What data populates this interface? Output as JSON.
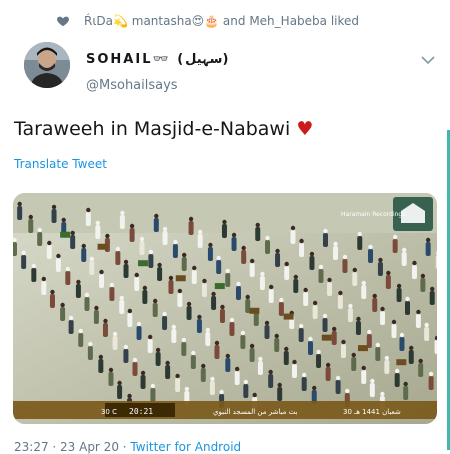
{
  "social_context": {
    "text": "ŔιDa💫 mantasha😍🎂 and Meh_Habeba liked"
  },
  "author": {
    "display_name": "SOHAIL👓 (سہیل)",
    "handle": "@Msohailsays"
  },
  "tweet": {
    "text": "Taraweeh in Masjid-e-Nabawi",
    "emoji": "♥",
    "translate_label": "Translate Tweet"
  },
  "media": {
    "overlay_channel": "Haramain Recordings",
    "ticker_right": "30 شعبان 1441 هـ",
    "ticker_middle": "بث مباشر من المسجد النبوي",
    "ticker_time": "20:21",
    "ticker_temp": "30 C"
  },
  "footer": {
    "timestamp": "23:27 · 23 Apr 20 · ",
    "client": "Twitter for Android"
  },
  "colors": {
    "accent": "#1b95e0",
    "heart": "#cc1b1b",
    "muted": "#657786"
  }
}
